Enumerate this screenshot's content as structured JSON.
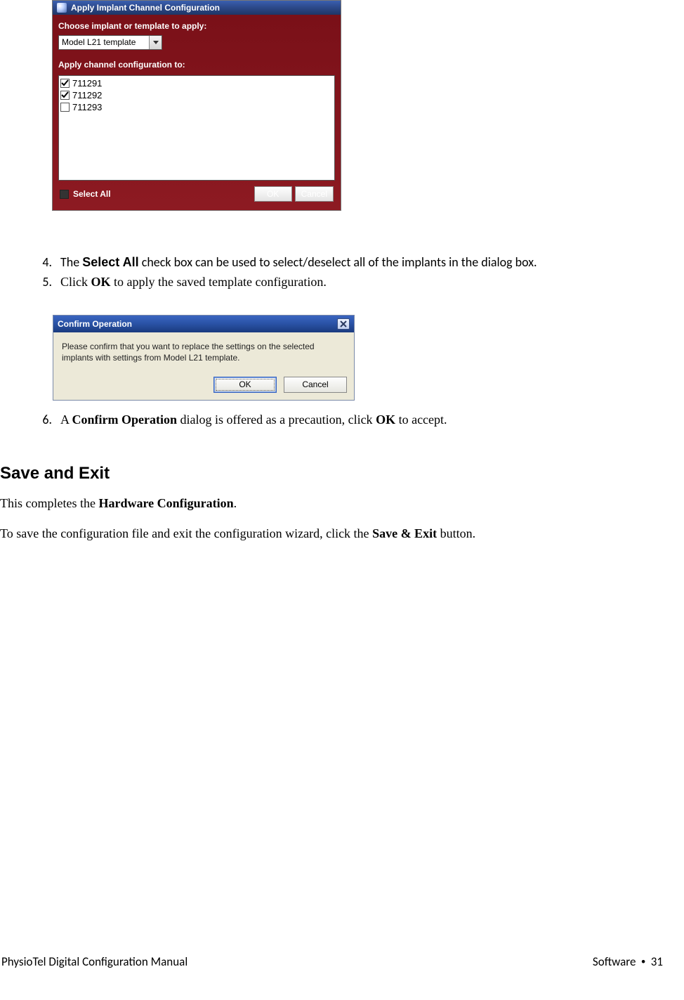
{
  "dialog1": {
    "title": "Apply Implant Channel Configuration",
    "choose_label": "Choose implant or template to apply:",
    "dropdown_value": "Model L21 template",
    "apply_label": "Apply channel configuration to:",
    "items": [
      {
        "label": "711291",
        "checked": true
      },
      {
        "label": "711292",
        "checked": true
      },
      {
        "label": "711293",
        "checked": false
      }
    ],
    "select_all_label": "Select All",
    "ok_label": "OK",
    "cancel_label": "Cancel"
  },
  "steps": {
    "s4": {
      "num": "4.",
      "pre": "The ",
      "bold1": "Select All",
      "post": " check box can be used to select/deselect all of the implants in the dialog box."
    },
    "s5": {
      "num": "5.",
      "pre": "Click ",
      "bold1": "OK",
      "post": " to apply the saved template configuration."
    },
    "s6": {
      "num": "6.",
      "pre": "A ",
      "bold1": "Confirm Operation",
      "mid": " dialog is offered as a precaution, click ",
      "bold2": "OK",
      "post": " to accept."
    }
  },
  "dialog2": {
    "title": "Confirm Operation",
    "body": "Please confirm that you want to replace the settings on the selected implants with settings from Model  L21 template.",
    "ok_label": "OK",
    "cancel_label": "Cancel"
  },
  "save_exit": {
    "heading": "Save and Exit",
    "p1_pre": "This completes the ",
    "p1_bold": "Hardware Configuration",
    "p1_post": ".",
    "p2_pre": "To save the configuration file and exit the configuration wizard, click the ",
    "p2_bold": "Save & Exit",
    "p2_post": " button."
  },
  "footer": {
    "left": "PhysioTel Digital Configuration Manual",
    "right_label": "Software",
    "right_bullet": "•",
    "right_page": "31"
  }
}
